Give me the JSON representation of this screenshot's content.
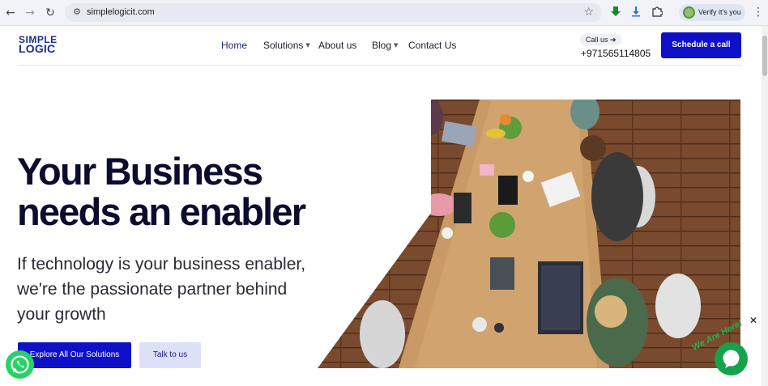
{
  "browser": {
    "url": "simplelogicit.com",
    "profile_label": "Verify it's you",
    "nav_icons": [
      "back-icon",
      "forward-icon",
      "reload-icon"
    ],
    "glyphs": {
      "back": "←",
      "forward": "→",
      "reload": "↻",
      "tune": "⚙",
      "star": "☆",
      "download": "⭳",
      "kebab": "⋮"
    }
  },
  "site": {
    "logo_line1": "SIMPLE",
    "logo_line2": "LOGIC",
    "menu": [
      {
        "label": "Home",
        "active": true
      },
      {
        "label": "Solutions",
        "has_caret": true
      },
      {
        "label": "About us"
      },
      {
        "label": "Blog",
        "has_caret": true
      },
      {
        "label": "Contact Us"
      }
    ],
    "caret": "▼",
    "call_us": "Call us ➔",
    "phone": "+971565114805",
    "schedule_button": "Schedule a call"
  },
  "hero": {
    "headline_line1": "Your Business",
    "headline_line2": "needs an enabler",
    "subtext_line1": "If technology is your business enabler,",
    "subtext_line2": "we're the passionate partner behind",
    "subtext_line3": "your growth",
    "primary_button": "Explore All Our Solutions",
    "secondary_button": "Talk to us"
  },
  "widgets": {
    "close": "✕",
    "chat_tag": "We Are Here!"
  },
  "colors": {
    "brand_blue": "#1010c8",
    "headline": "#0c0c2e",
    "whatsapp": "#25d366",
    "chat_green": "#14a34a"
  }
}
